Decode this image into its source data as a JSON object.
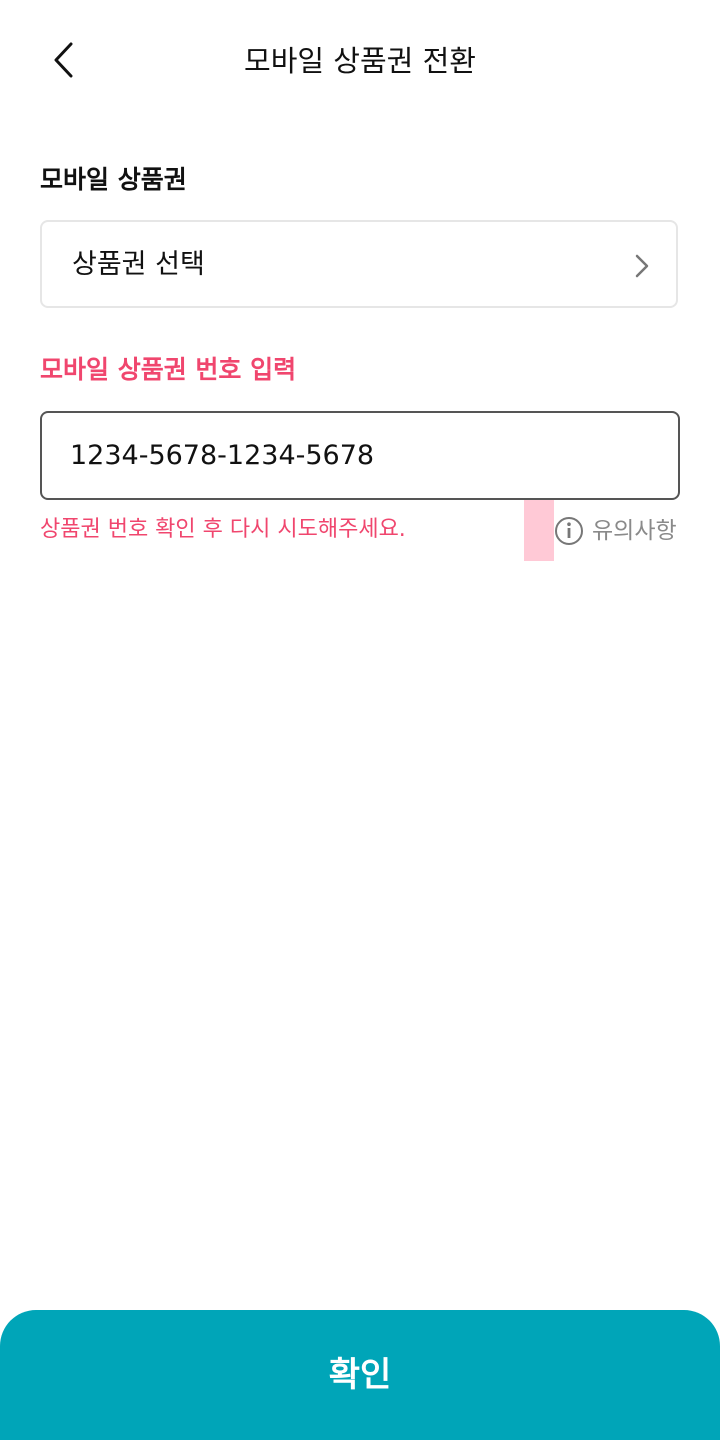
{
  "header": {
    "title": "모바일 상품권 전환",
    "back_icon": "chevron-left-icon"
  },
  "gift_card_section": {
    "label": "모바일 상품권",
    "select_placeholder": "상품권 선택",
    "select_icon": "chevron-right-icon"
  },
  "number_section": {
    "label": "모바일 상품권 번호 입력",
    "input_value": "1234-5678-1234-5678",
    "error_message": "상품권 번호 확인 후 다시 시도해주세요.",
    "notice_label": "유의사항",
    "notice_icon": "info-icon"
  },
  "footer": {
    "confirm_label": "확인"
  },
  "colors": {
    "accent": "#00a5b8",
    "error": "#f0466e",
    "marker": "#ffc9d6",
    "muted": "#8a8a8a"
  }
}
